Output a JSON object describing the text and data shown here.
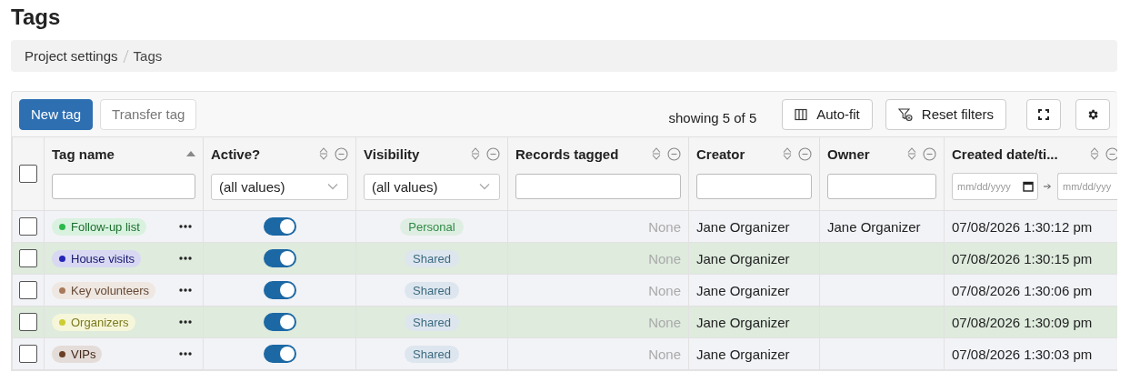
{
  "page_title": "Tags",
  "breadcrumb": [
    "Project settings",
    "Tags"
  ],
  "toolbar": {
    "buttons": [
      {
        "label": "New tag",
        "primary": true
      },
      {
        "label": "Transfer tag",
        "primary": false
      }
    ],
    "count": "showing 5 of 5",
    "auto_fit": "Auto-fit",
    "reset_filters": "Reset filters"
  },
  "table": {
    "all_checked": false,
    "columns": [
      {
        "label": "Tag name",
        "sorted": true,
        "filter": {
          "kind": "text"
        }
      },
      {
        "label": "Active?",
        "sorted": false,
        "filter": {
          "kind": "select",
          "value": "(all values)"
        }
      },
      {
        "label": "Visibility",
        "sorted": false,
        "filter": {
          "kind": "select",
          "value": "(all values)"
        }
      },
      {
        "label": "Records tagged",
        "sorted": false,
        "filter": {
          "kind": "text"
        }
      },
      {
        "label": "Creator",
        "sorted": false,
        "filter": {
          "kind": "text"
        }
      },
      {
        "label": "Owner",
        "sorted": false,
        "filter": {
          "kind": "text"
        }
      },
      {
        "label": "Created date/ti...",
        "sorted": false,
        "filter": {
          "kind": "daterange",
          "from_placeholder": "mm/dd/yyyy",
          "to_placeholder": "mm/dd/yyy"
        }
      }
    ],
    "rows": [
      {
        "checked": false,
        "tag": "Follow-up list",
        "color": "#2db84d",
        "active": true,
        "visibility": "Personal",
        "personal": true,
        "records": "None",
        "creator": "Jane Organizer",
        "owner": "Jane Organizer",
        "created": "07/08/2026 1:30:12 pm"
      },
      {
        "checked": false,
        "tag": "House visits",
        "color": "#2424b8",
        "active": true,
        "visibility": "Shared",
        "personal": false,
        "records": "None",
        "creator": "Jane Organizer",
        "created": "07/08/2026 1:30:15 pm"
      },
      {
        "checked": false,
        "tag": "Key volunteers",
        "color": "#a8795a",
        "active": true,
        "visibility": "Shared",
        "personal": false,
        "records": "None",
        "creator": "Jane Organizer",
        "created": "07/08/2026 1:30:06 pm"
      },
      {
        "checked": false,
        "tag": "Organizers",
        "color": "#cccc33",
        "active": true,
        "visibility": "Shared",
        "personal": false,
        "records": "None",
        "creator": "Jane Organizer",
        "created": "07/08/2026 1:30:09 pm"
      },
      {
        "checked": false,
        "tag": "VIPs",
        "color": "#6b3e26",
        "active": true,
        "visibility": "Shared",
        "personal": false,
        "records": "None",
        "creator": "Jane Organizer",
        "created": "07/08/2026 1:30:03 pm"
      }
    ]
  }
}
